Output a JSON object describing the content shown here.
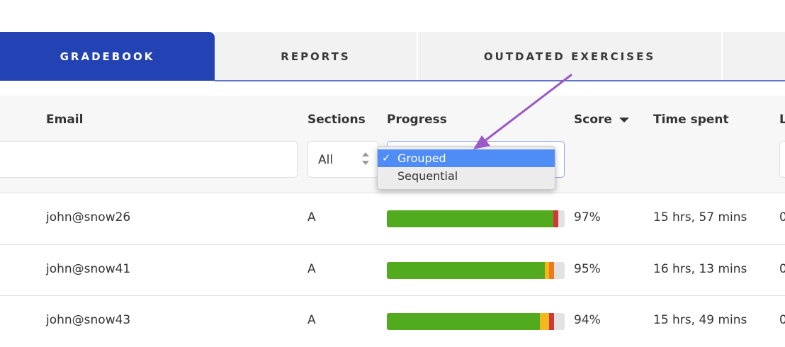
{
  "tabs": [
    {
      "label": "GRADEBOOK",
      "active": true
    },
    {
      "label": "REPORTS",
      "active": false
    },
    {
      "label": "OUTDATED EXERCISES",
      "active": false
    }
  ],
  "columns": {
    "email": "Email",
    "sections": "Sections",
    "progress": "Progress",
    "score": "Score",
    "time_spent": "Time spent",
    "last": "L"
  },
  "filters": {
    "email_value": "",
    "sections_value": "All",
    "last_value": ""
  },
  "progress_dropdown": {
    "selected": "Grouped",
    "options": [
      {
        "label": "Grouped",
        "check": "✓",
        "selected": true
      },
      {
        "label": "Sequential",
        "check": "",
        "selected": false
      }
    ]
  },
  "rows": [
    {
      "email": "john@snow26",
      "section": "A",
      "score": "97%",
      "time": "15 hrs, 57 mins",
      "last": "0",
      "progress": [
        {
          "color": "#52ab1e",
          "fraction": 0.938
        },
        {
          "color": "#d23737",
          "fraction": 0.028
        }
      ]
    },
    {
      "email": "john@snow41",
      "section": "A",
      "score": "95%",
      "time": "16 hrs, 13 mins",
      "last": "0",
      "progress": [
        {
          "color": "#52ab1e",
          "fraction": 0.89
        },
        {
          "color": "#f2b81e",
          "fraction": 0.024
        },
        {
          "color": "#ef7a1c",
          "fraction": 0.028
        }
      ]
    },
    {
      "email": "john@snow43",
      "section": "A",
      "score": "94%",
      "time": "15 hrs, 49 mins",
      "last": "0",
      "progress": [
        {
          "color": "#52ab1e",
          "fraction": 0.86
        },
        {
          "color": "#f2b81e",
          "fraction": 0.052
        },
        {
          "color": "#d23737",
          "fraction": 0.028
        }
      ]
    }
  ],
  "colors": {
    "tab_active": "#2342b4",
    "tab_inactive": "#f2f2f2",
    "dropdown_selected": "#4f8cf6",
    "annotation_arrow": "#9b59c6",
    "bar_track": "#e2e2e2"
  },
  "icons": {
    "sort": "caret-down-icon",
    "sections_stepper": "updown-stepper-icon",
    "check": "checkmark-icon",
    "annotation": "arrow-icon"
  }
}
